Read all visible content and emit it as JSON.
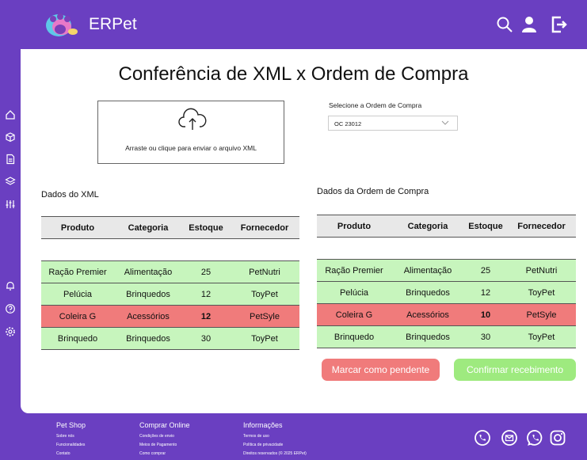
{
  "header": {
    "brand": "ERPet",
    "icons": [
      "search-icon",
      "user-icon",
      "logout-icon"
    ]
  },
  "sidebar": {
    "icons": [
      "home-icon",
      "box-icon",
      "document-icon",
      "layers-icon",
      "sliders-icon",
      "bell-icon",
      "help-icon",
      "settings-icon"
    ]
  },
  "page": {
    "title": "Conferência de XML x Ordem de Compra"
  },
  "upload": {
    "text": "Arraste ou clique para enviar o arquivo XML"
  },
  "order_select": {
    "label": "Selecione a Ordem de Compra",
    "value": "OC 23012"
  },
  "xml_section": {
    "label": "Dados do XML",
    "columns": [
      "Produto",
      "Categoria",
      "Estoque",
      "Fornecedor"
    ],
    "rows": [
      {
        "produto": "Ração Premier",
        "categoria": "Alimentação",
        "estoque": "25",
        "fornecedor": "PetNutri",
        "status": "ok"
      },
      {
        "produto": "Pelúcia",
        "categoria": "Brinquedos",
        "estoque": "12",
        "fornecedor": "ToyPet",
        "status": "ok"
      },
      {
        "produto": "Coleira G",
        "categoria": "Acessórios",
        "estoque": "12",
        "fornecedor": "PetSyle",
        "status": "bad"
      },
      {
        "produto": "Brinquedo",
        "categoria": "Brinquedos",
        "estoque": "30",
        "fornecedor": "ToyPet",
        "status": "ok"
      }
    ]
  },
  "order_section": {
    "label": "Dados da Ordem de Compra",
    "columns": [
      "Produto",
      "Categoria",
      "Estoque",
      "Fornecedor"
    ],
    "rows": [
      {
        "produto": "Ração Premier",
        "categoria": "Alimentação",
        "estoque": "25",
        "fornecedor": "PetNutri",
        "status": "ok"
      },
      {
        "produto": "Pelúcia",
        "categoria": "Brinquedos",
        "estoque": "12",
        "fornecedor": "ToyPet",
        "status": "ok"
      },
      {
        "produto": "Coleira G",
        "categoria": "Acessórios",
        "estoque": "10",
        "fornecedor": "PetSyle",
        "status": "bad"
      },
      {
        "produto": "Brinquedo",
        "categoria": "Brinquedos",
        "estoque": "30",
        "fornecedor": "ToyPet",
        "status": "ok"
      }
    ]
  },
  "actions": {
    "pending": "Marcar como pendente",
    "confirm": "Confirmar recebimento"
  },
  "footer": {
    "columns": [
      {
        "title": "Pet Shop",
        "links": [
          "Sobre nós",
          "Funcionalidades",
          "Contato"
        ]
      },
      {
        "title": "Comprar Online",
        "links": [
          "Condições de envio",
          "Meios de Pagamento",
          "Como comprar"
        ]
      },
      {
        "title": "Informações",
        "links": [
          "Termos de uso",
          "Política de privacidade",
          "Direitos reservados (© 2025 ERPet)"
        ]
      }
    ],
    "social": [
      "whatsapp-phone-icon",
      "mail-icon",
      "whatsapp-icon",
      "instagram-icon"
    ]
  },
  "colors": {
    "primary": "#6a3fc1",
    "ok_row": "#c7f5bd",
    "bad_row": "#f07b7b",
    "confirm_btn": "#9eea7f"
  }
}
